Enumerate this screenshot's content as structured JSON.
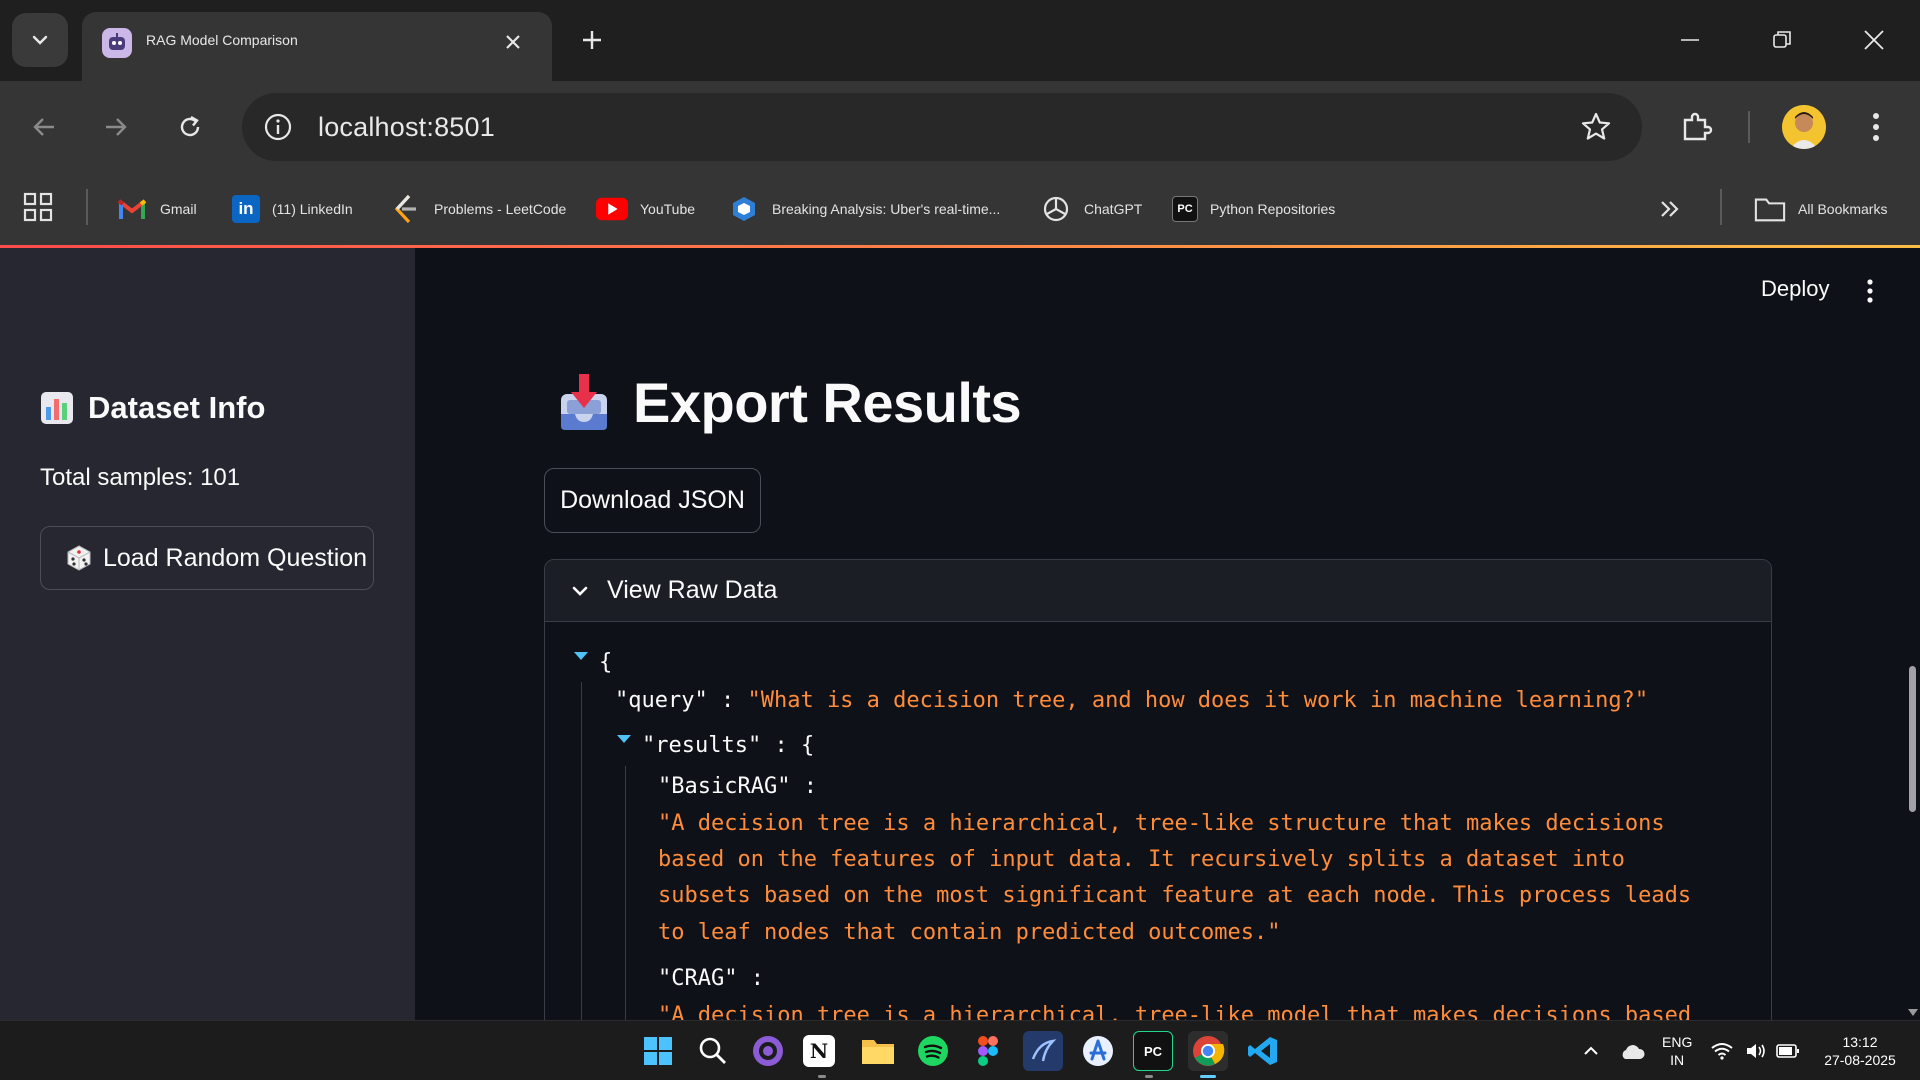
{
  "browser": {
    "tab_title": "RAG Model Comparison",
    "url": "localhost:8501",
    "bookmarks": [
      {
        "label": "Gmail",
        "icon": "gmail-icon"
      },
      {
        "label": "(11) LinkedIn",
        "icon": "linkedin-icon"
      },
      {
        "label": "Problems - LeetCode",
        "icon": "leetcode-icon"
      },
      {
        "label": "YouTube",
        "icon": "youtube-icon"
      },
      {
        "label": "Breaking Analysis: Uber's real-time...",
        "icon": "article-icon"
      },
      {
        "label": "ChatGPT",
        "icon": "chatgpt-icon"
      },
      {
        "label": "Python Repositories",
        "icon": "pycharm-icon"
      }
    ],
    "all_bookmarks": "All Bookmarks"
  },
  "sidebar": {
    "title": "Dataset Info",
    "title_icon": "bar-chart-icon",
    "total_samples": "Total samples: 101",
    "load_button": "Load Random Question",
    "load_button_icon": "dice-icon"
  },
  "main": {
    "deploy": "Deploy",
    "title": "Export Results",
    "title_icon": "inbox-tray-icon",
    "download_button": "Download JSON",
    "expander_label": "View Raw Data",
    "json": {
      "open_brace": "{",
      "query_key": "\"query\"",
      "query_sep": " : ",
      "query_value": "\"What is a decision tree, and how does it work in machine learning?\"",
      "results_key": "\"results\"",
      "results_sep": " : {",
      "basic_key": "\"BasicRAG\" :",
      "basic_lines": [
        "\"A decision tree is a hierarchical, tree-like structure that makes decisions",
        "based on the features of input data. It recursively splits a dataset into",
        "subsets based on the most significant feature at each node. This process leads",
        "to leaf nodes that contain predicted outcomes.\""
      ],
      "crag_key": "\"CRAG\" :",
      "crag_partial": "\"A decision tree is a hierarchical, tree-like model that makes decisions based"
    }
  },
  "taskbar": {
    "lang": "ENG",
    "region": "IN",
    "time": "13:12",
    "date": "27-08-2025"
  },
  "colors": {
    "app_bg": "#0e1117",
    "sidebar_bg": "#262730",
    "json_string": "#ff8c3a",
    "json_toggle": "#4fc3f7",
    "accent": "#ff4b4b"
  }
}
